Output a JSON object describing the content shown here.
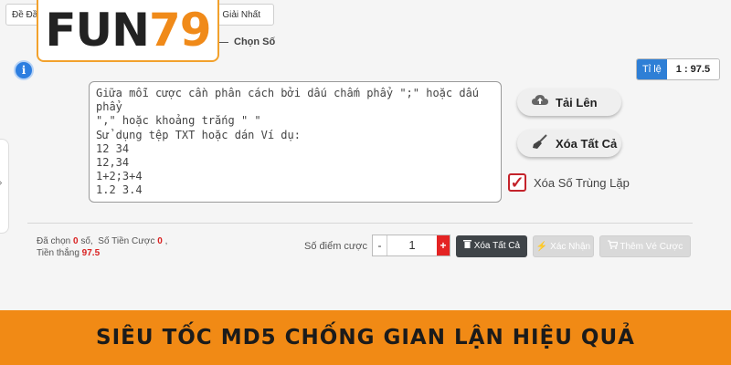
{
  "tabs": {
    "left_label": "Đề Đầ",
    "right_label": "ề Giải Nhất"
  },
  "logo": {
    "fun": "FUN",
    "num": "79"
  },
  "chon_so_label": "Chọn Số",
  "info_glyph": "i",
  "odds": {
    "label": "Tỉ lệ",
    "value": "1 : 97.5"
  },
  "textarea": {
    "placeholder": "Giữa mỗi cược cần phân cách bởi dấu chấm phẩy \";\" hoặc dấu phẩy\n\",\" hoặc khoảng trắng \" \"\nSử dụng tệp TXT hoặc dán Ví dụ:\n12 34\n12,34\n1+2;3+4\n1.2 3.4"
  },
  "buttons": {
    "upload": "Tải Lên",
    "clear_all": "Xóa Tất Cả",
    "clear_all_small": "Xóa Tất Cả",
    "confirm": "Xác Nhận",
    "add_to_bet": "Thêm Vé Cược"
  },
  "duplicate": {
    "label": "Xóa Số Trùng Lặp",
    "checked": true
  },
  "stats": {
    "selected_label": "Đã chọn",
    "selected_value": "0",
    "selected_unit": "số,",
    "amount_label": "Số Tiền Cược",
    "amount_value": "0",
    "amount_suffix": ",",
    "win_label": "Tiền thắng",
    "win_value": "97.5"
  },
  "points": {
    "label": "Số điểm cược",
    "value": "1",
    "minus": "-",
    "plus": "+"
  },
  "banner": {
    "text": "SIÊU TỐC MD5 CHỐNG GIAN LẬN HIỆU QUẢ"
  },
  "colors": {
    "accent_orange": "#f18a15",
    "blue": "#2e7fd6",
    "red": "#e42323"
  },
  "icons": {
    "upload": "cloud-upload-icon",
    "clear": "broom-icon",
    "trash": "trash-icon",
    "confirm": "bolt-icon",
    "cart": "cart-icon"
  }
}
